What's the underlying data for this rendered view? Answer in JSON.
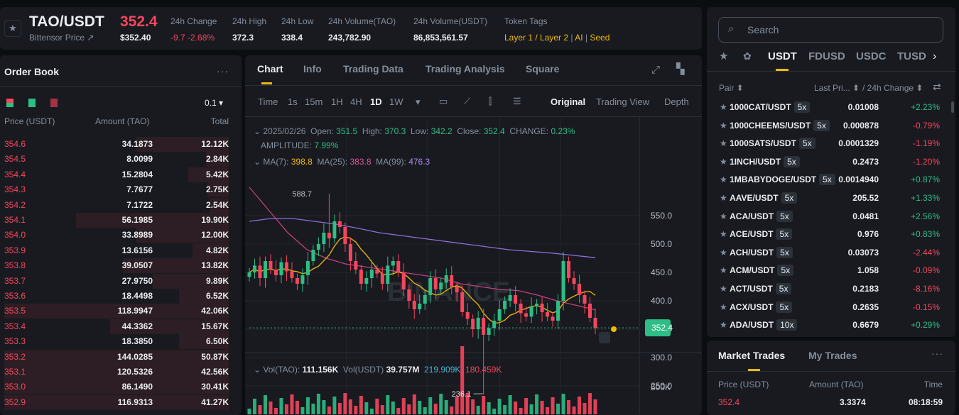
{
  "header": {
    "symbol": "TAO/USDT",
    "name": "Bittensor Price ↗",
    "last_price": "352.4",
    "last_usd": "$352.40",
    "stats": [
      {
        "label": "24h Change",
        "value": "-9.7 -2.68%",
        "color": "#f6465d"
      },
      {
        "label": "24h High",
        "value": "372.3"
      },
      {
        "label": "24h Low",
        "value": "338.4"
      },
      {
        "label": "24h Volume(TAO)",
        "value": "243,782.90"
      },
      {
        "label": "24h Volume(USDT)",
        "value": "86,853,561.57"
      }
    ],
    "tags_label": "Token Tags",
    "tags": [
      "Layer 1 / Layer 2",
      "AI",
      "Seed"
    ]
  },
  "order_book": {
    "title": "Order Book",
    "more": "···",
    "precision": "0.1 ▾",
    "columns": [
      "Price (USDT)",
      "Amount (TAO)",
      "Total"
    ],
    "asks": [
      [
        "354.6",
        "34.1873",
        "12.12K",
        0.41
      ],
      [
        "354.5",
        "8.0099",
        "2.84K",
        0.1
      ],
      [
        "354.4",
        "15.2804",
        "5.42K",
        0.18
      ],
      [
        "354.3",
        "7.7677",
        "2.75K",
        0.095
      ],
      [
        "354.2",
        "7.1722",
        "2.54K",
        0.085
      ],
      [
        "354.1",
        "56.1985",
        "19.90K",
        0.68
      ],
      [
        "354.0",
        "33.8989",
        "12.00K",
        0.41
      ],
      [
        "353.9",
        "13.6156",
        "4.82K",
        0.16
      ],
      [
        "353.8",
        "39.0507",
        "13.82K",
        0.47
      ],
      [
        "353.7",
        "27.9750",
        "9.89K",
        0.34
      ],
      [
        "353.6",
        "18.4498",
        "6.52K",
        0.22
      ],
      [
        "353.5",
        "118.9947",
        "42.06K",
        1
      ],
      [
        "353.4",
        "44.3362",
        "15.67K",
        0.53
      ],
      [
        "353.3",
        "18.3850",
        "6.50K",
        0.22
      ],
      [
        "353.2",
        "144.0285",
        "50.87K",
        1
      ],
      [
        "353.1",
        "120.5326",
        "42.56K",
        1
      ],
      [
        "353.0",
        "86.1490",
        "30.41K",
        1
      ],
      [
        "352.9",
        "116.9313",
        "41.27K",
        1
      ]
    ]
  },
  "chart_panel": {
    "tabs": [
      "Chart",
      "Info",
      "Trading Data",
      "Trading Analysis",
      "Square"
    ],
    "active_tab": "Chart",
    "timeframes": [
      "Time",
      "1s",
      "15m",
      "1H",
      "4H",
      "1D",
      "1W",
      "▾"
    ],
    "active_tf": "1D",
    "views": [
      "Original",
      "Trading View",
      "Depth"
    ],
    "active_view": "Original",
    "ohlc": {
      "date": "2025/02/26",
      "open_label": "Open:",
      "open": "351.5",
      "high_label": "High:",
      "high": "370.3",
      "low_label": "Low:",
      "low": "342.2",
      "close_label": "Close:",
      "close": "352.4",
      "change_label": "CHANGE:",
      "change": "0.23%",
      "amp_label": "AMPLITUDE:",
      "amp": "7.99%"
    },
    "ma": {
      "ma7_label": "MA(7):",
      "ma7": "398.8",
      "ma25_label": "MA(25):",
      "ma25": "383.8",
      "ma99_label": "MA(99):",
      "ma99": "476.3"
    },
    "vol": {
      "vol_tao_label": "Vol(TAO):",
      "vol_tao": "111.156K",
      "vol_usdt_label": "Vol(USDT)",
      "vol_usdt": "39.757M",
      "ma1": "219.909K",
      "ma2": "180.459K"
    },
    "watermark": "BINANCE"
  },
  "chart_data": {
    "type": "candlestick",
    "y_ticks": [
      "550.0",
      "500.0",
      "450.0",
      "400.0",
      "350.0",
      "300.0",
      "250.0"
    ],
    "y_tick_values": [
      550,
      500,
      450,
      400,
      350,
      300,
      250
    ],
    "ylim": [
      215,
      615
    ],
    "max_label": "588.7",
    "min_label": "236.1",
    "current_price": "352.4",
    "vol_tick": "500K",
    "colors": {
      "up": "#2ebd85",
      "down": "#f6465d",
      "ma7": "#f0b90b",
      "ma25": "#c2407a",
      "ma99": "#8c6fd6"
    },
    "closes": [
      450,
      462,
      440,
      470,
      455,
      445,
      468,
      452,
      440,
      430,
      445,
      470,
      490,
      500,
      520,
      510,
      540,
      530,
      500,
      470,
      455,
      430,
      440,
      455,
      448,
      430,
      462,
      470,
      450,
      420,
      400,
      385,
      395,
      410,
      440,
      420,
      432,
      445,
      425,
      415,
      380,
      368,
      350,
      370,
      340,
      352,
      365,
      385,
      400,
      410,
      395,
      378,
      372,
      390,
      395,
      380,
      372,
      365,
      400,
      470,
      440,
      430,
      410,
      395,
      370,
      352
    ],
    "ma25": [
      600,
      560,
      520,
      490,
      475,
      465,
      460,
      455,
      450,
      445,
      440,
      430,
      425,
      420,
      418,
      410,
      400,
      392,
      384
    ],
    "ma99": [
      540,
      545,
      545,
      540,
      535,
      528,
      520,
      515,
      510,
      505,
      500,
      495,
      490,
      487,
      484,
      480,
      476
    ]
  },
  "markets": {
    "search_placeholder": "Search",
    "tabs": [
      "USDT",
      "FDUSD",
      "USDC",
      "TUSD"
    ],
    "active": "USDT",
    "columns": [
      "Pair ⬍",
      "Last Pri... ⬍",
      "/ 24h Change ⬍"
    ],
    "rows": [
      [
        "1000CAT/USDT",
        "5x",
        "0.01008",
        "+2.23%"
      ],
      [
        "1000CHEEMS/USDT",
        "5x",
        "0.000878",
        "-0.79%"
      ],
      [
        "1000SATS/USDT",
        "5x",
        "0.0001329",
        "-1.19%"
      ],
      [
        "1INCH/USDT",
        "5x",
        "0.2473",
        "-1.20%"
      ],
      [
        "1MBABYDOGE/USDT",
        "5x",
        "0.0014940",
        "+0.87%"
      ],
      [
        "AAVE/USDT",
        "5x",
        "205.52",
        "+1.33%"
      ],
      [
        "ACA/USDT",
        "5x",
        "0.0481",
        "+2.56%"
      ],
      [
        "ACE/USDT",
        "5x",
        "0.976",
        "+0.83%"
      ],
      [
        "ACH/USDT",
        "5x",
        "0.03073",
        "-2.44%"
      ],
      [
        "ACM/USDT",
        "5x",
        "1.058",
        "-0.09%"
      ],
      [
        "ACT/USDT",
        "5x",
        "0.2183",
        "-8.16%"
      ],
      [
        "ACX/USDT",
        "5x",
        "0.2635",
        "-0.15%"
      ],
      [
        "ADA/USDT",
        "10x",
        "0.6679",
        "+0.29%"
      ]
    ]
  },
  "trades": {
    "tabs": [
      "Market Trades",
      "My Trades"
    ],
    "more": "···",
    "columns": [
      "Price (USDT)",
      "Amount (TAO)",
      "Time"
    ],
    "rows": [
      [
        "352.4",
        "3.3374",
        "08:18:59"
      ]
    ]
  }
}
